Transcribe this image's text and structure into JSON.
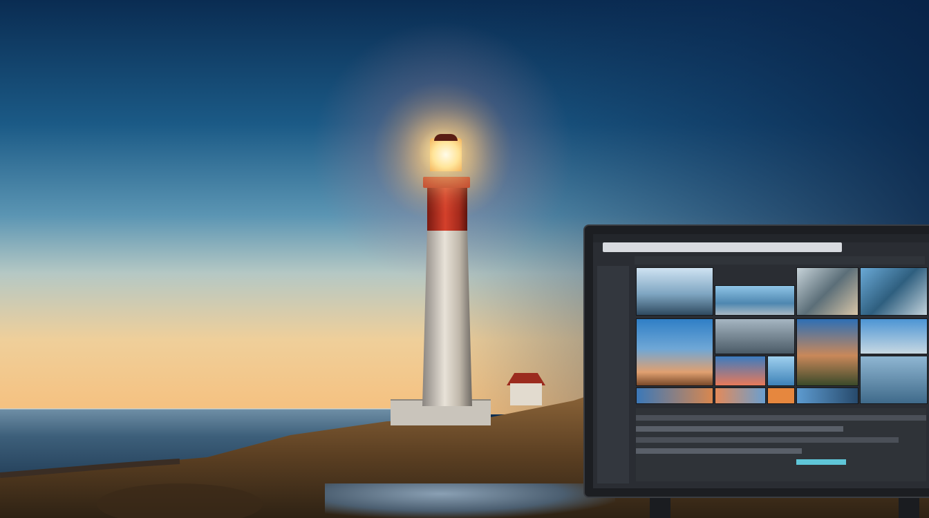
{
  "scene": {
    "subject": "lighthouse",
    "colors": {
      "sky_top": "#0a2c52",
      "sky_horizon": "#f6c07e",
      "lamp_light": "#ffe59a",
      "tower_red": "#c93a27",
      "tower_white": "#e8e2d8",
      "hill": "#6b4a2a",
      "monitor_frame": "#1c1e22"
    },
    "icons": [
      "lighthouse-icon",
      "sun-glow-icon",
      "monitor-icon"
    ]
  }
}
